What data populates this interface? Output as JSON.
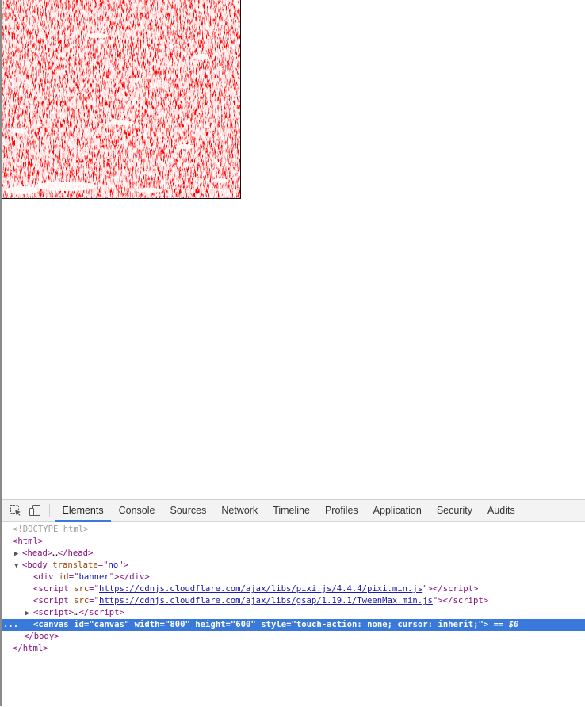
{
  "devtools": {
    "tabs": [
      "Elements",
      "Console",
      "Sources",
      "Network",
      "Timeline",
      "Profiles",
      "Application",
      "Security",
      "Audits"
    ],
    "active_tab": "Elements",
    "dom": {
      "doctype": "<!DOCTYPE html>",
      "html_open": "html",
      "head": "head",
      "head_ellipsis": "…",
      "body_tag": "body",
      "body_attr_name": "translate",
      "body_attr_value": "no",
      "div_tag": "div",
      "div_attr_name": "id",
      "div_attr_value": "banner",
      "script_tag": "script",
      "script_attr_name": "src",
      "script1_src": "https://cdnjs.cloudflare.com/ajax/libs/pixi.js/4.4.4/pixi.min.js",
      "script2_src": "https://cdnjs.cloudflare.com/ajax/libs/gsap/1.19.1/TweenMax.min.js",
      "script3_ellipsis": "…",
      "canvas_tag": "canvas",
      "canvas_id_name": "id",
      "canvas_id_value": "canvas",
      "canvas_width_name": "width",
      "canvas_width_value": "800",
      "canvas_height_name": "height",
      "canvas_height_value": "600",
      "canvas_style_name": "style",
      "canvas_style_value": "touch-action: none; cursor: inherit;",
      "selected_marker": "== $0",
      "gutter_dots": "...",
      "body_close": "body",
      "html_close": "html"
    }
  },
  "colors": {
    "canvas_fill": "#ff0000",
    "selection": "#3879d9",
    "tag": "#881280",
    "attr_name": "#994500",
    "attr_value": "#1a1aa6"
  },
  "icons": {
    "inspect": "select-element-icon",
    "device": "device-mode-icon"
  }
}
